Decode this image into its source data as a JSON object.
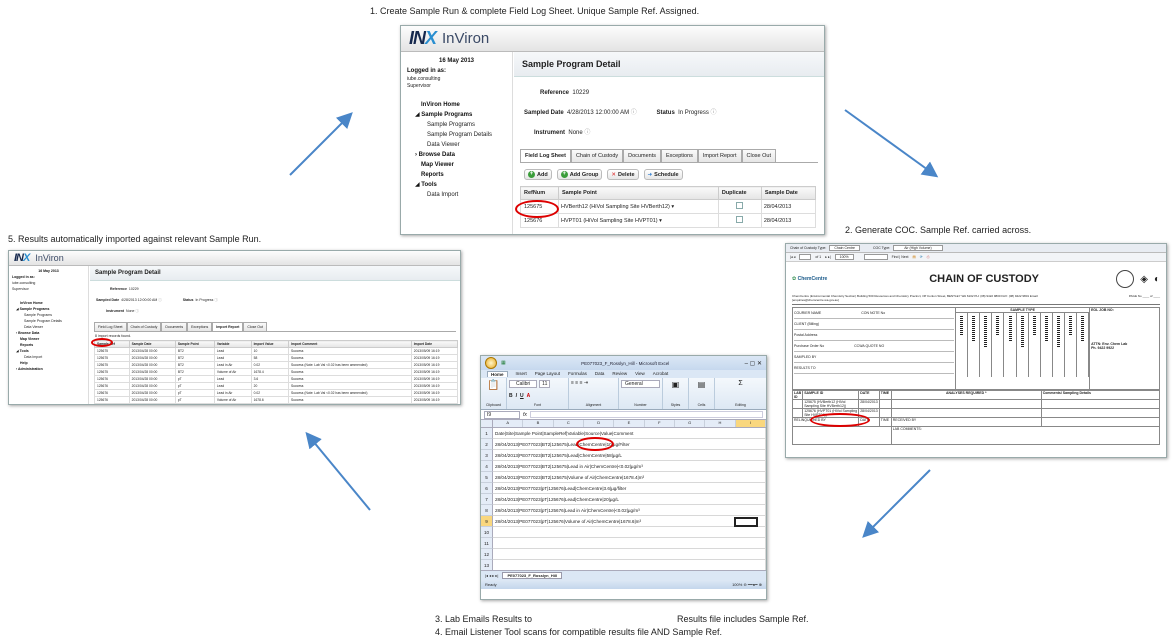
{
  "captions": {
    "step1": "1.  Create Sample Run & complete Field Log Sheet. Unique Sample Ref. Assigned.",
    "step2": "2.  Generate COC. Sample Ref. carried across.",
    "step3a": "3.  Lab Emails Results to",
    "step3b": "Results file includes Sample Ref.",
    "step4": "4.  Email Listener Tool scans for compatible results file AND Sample Ref.",
    "step5": "5.  Results automatically imported against relevant Sample Run."
  },
  "app": {
    "logo_mark": "INX",
    "logo_name": "InViron",
    "date": "16 May 2013",
    "logged_in_label": "Logged in as:",
    "user": "iube.consulting",
    "role": "Supervisor",
    "nav": {
      "home": "InViron Home",
      "sample_programs": "Sample Programs",
      "sub_sample_programs": "Sample Programs",
      "sub_sample_program_details": "Sample Program Details",
      "sub_data_viewer": "Data Viewer",
      "browse_data": "Browse Data",
      "map_viewer": "Map Viewer",
      "reports": "Reports",
      "tools": "Tools",
      "sub_data_import": "Data Import",
      "help": "Help",
      "administration": "Administration"
    },
    "page_title": "Sample Program Detail",
    "reference_label": "Reference",
    "reference_value": "10229",
    "sampled_date_label": "Sampled Date",
    "sampled_date_value": "4/28/2013 12:00:00 AM",
    "status_label": "Status",
    "status_value": "In Progress",
    "instrument_label": "Instrument",
    "instrument_value": "None",
    "tabs": [
      "Field Log Sheet",
      "Chain of Custody",
      "Documents",
      "Exceptions",
      "Import Report",
      "Close Out"
    ],
    "buttons": {
      "add": "Add",
      "add_group": "Add Group",
      "delete": "Delete",
      "schedule": "Schedule"
    },
    "field_cols": [
      "RefNum",
      "Sample Point",
      "Duplicate",
      "Sample Date"
    ],
    "field_rows": [
      {
        "ref": "125675",
        "point": "HVBerth12  (HiVol Sampling Site HVBerth12)",
        "date": "28/04/2013"
      },
      {
        "ref": "125676",
        "point": "HVPT01  (HiVol Sampling Site HVPT01)",
        "date": "28/04/2013"
      }
    ],
    "import_count": "8 import records found.",
    "import_cols": [
      "Sample Ref",
      "Sample Date",
      "Sample Point",
      "Variable",
      "Import Value",
      "Import Comment",
      "Import Date"
    ],
    "import_rows": [
      [
        "125675",
        "2013/04/28 00:00",
        "BT2",
        "Lead",
        "10",
        "Success",
        "2013/05/09 16:19"
      ],
      [
        "125675",
        "2013/04/28 00:00",
        "BT2",
        "Lead",
        "58",
        "Success",
        "2013/05/09 16:19"
      ],
      [
        "125675",
        "2013/04/28 00:00",
        "BT2",
        "Lead in Air",
        "0.02",
        "Success (Note: Lab Val <0.02 has been ammended)",
        "2013/05/09 16:19"
      ],
      [
        "125675",
        "2013/04/28 00:00",
        "BT2",
        "Volume of Air",
        "1678.4",
        "Success",
        "2013/05/09 16:19"
      ],
      [
        "125676",
        "2013/04/28 00:00",
        "pT",
        "Lead",
        "3.6",
        "Success",
        "2013/05/09 16:19"
      ],
      [
        "125676",
        "2013/04/28 00:00",
        "pT",
        "Lead",
        "20",
        "Success",
        "2013/05/09 16:19"
      ],
      [
        "125676",
        "2013/04/28 00:00",
        "pT",
        "Lead in Air",
        "0.02",
        "Success (Note: Lab Val <0.02 has been ammended)",
        "2013/05/09 16:19"
      ],
      [
        "125676",
        "2013/04/28 00:00",
        "pT",
        "Volume of Air",
        "1678.6",
        "Success",
        "2013/05/09 16:19"
      ]
    ]
  },
  "coc": {
    "toolbar_type_label": "Chain of Custody Type:",
    "toolbar_type_value": "Chain Centre",
    "toolbar_coc_label": "COC Type:",
    "toolbar_coc_value": "Air (High Volume)",
    "page_label": "of 1",
    "zoom": "100%",
    "find_label": "Find | Next",
    "lab_logo": "ChemCentre",
    "title": "CHAIN OF CUSTODY",
    "address": "ChemCentre (Environmental Chemistry Section) Building 500 Resources and Chemistry Precinct, Off Conlon Street, BENTLEY WA 6102  PH: (08) 9422 9800  FAX: (08) 9422 9801 Email: [enquiries@chemcentre.wa.gov.au]",
    "page_no": "PAGE No ____ of ____",
    "sample_type": "SAMPLE TYPE",
    "eol_job": "EOL JOB NO:",
    "fields": [
      "COURIER NAME",
      "CLIENT (Billing)",
      "Postal Address",
      "Purchase Order No",
      "SAMPLED BY",
      "RESULTS TO"
    ],
    "con_note": "CON NOTE No",
    "quote_no": "CCWA QUOTE NO",
    "attn": "ATTN: Env. Chem Lab\nPh. 9422 9922",
    "grid_cols": [
      "LAB ID",
      "SAMPLE ID",
      "DATE",
      "TIME",
      "ANALYSES REQUIRED *"
    ],
    "comments_head": "Comments/ Sampling Details",
    "sample_ids": [
      "125675 (HVBerth12 (HiVol Sampling Site HVBerth12))",
      "125676 (HVPT01 (HiVol Sampling Site HVPT01))"
    ],
    "dates": [
      "28/04/2013",
      "28/04/2013"
    ],
    "relinq": "RELINQUISHED BY",
    "received": "RECEIVED BY",
    "lab_comments": "LAB COMMENTS:"
  },
  "excel": {
    "title": "PE077023_F_Rosslyn_Hill - Microsoft Excel",
    "ribbon_tabs": [
      "Home",
      "Insert",
      "Page Layout",
      "Formulas",
      "Data",
      "Review",
      "View",
      "Acrobat"
    ],
    "groups": [
      "Clipboard",
      "Font",
      "Alignment",
      "Number",
      "Styles",
      "Cells",
      "Editing"
    ],
    "font": "Calibri",
    "font_size": "11",
    "number_format": "General",
    "name_box": "I9",
    "columns": [
      "A",
      "B",
      "C",
      "D",
      "E",
      "F",
      "G",
      "H",
      "I"
    ],
    "rows": [
      "Date|Site|Sample Point|SampleRef|Variable|Source|Value|Comment",
      "28/04/2013|PE077023|BT2|125675|Lead|ChemCentre|10|µg/Filter",
      "28/04/2013|PE077023|BT2|125675|Lead|ChemCentre|58|µg/L",
      "28/04/2013|PE077023|BT2|125675|Lead in Air|ChemCentre|<0.02|µg/m³",
      "28/04/2013|PE077023|BT2|125675|Volume of Air|ChemCentre|1678.4|m³",
      "28/04/2013|PE077023|pT|125676|Lead|ChemCentre|3.6|µg/filter",
      "28/04/2013|PE077023|pT|125676|Lead|ChemCentre|20|µg/L",
      "28/04/2013|PE077023|pT|125676|Lead in Air|ChemCentre|<0.02|µg/m³",
      "28/04/2013|PE077023|pT|125676|Volume of Air|ChemCentre|1678.6|m³",
      "",
      "",
      "",
      ""
    ],
    "sheet_tab": "PE077023_F_Rosslyn_Hill",
    "status": "Ready",
    "zoom": "100%"
  },
  "colors": {
    "arrow": "#4a86c8",
    "highlight_ring": "#dd0000",
    "inx_navy": "#16294e",
    "inx_blue": "#2a8fd0",
    "excel_green": "#1e7b34"
  }
}
